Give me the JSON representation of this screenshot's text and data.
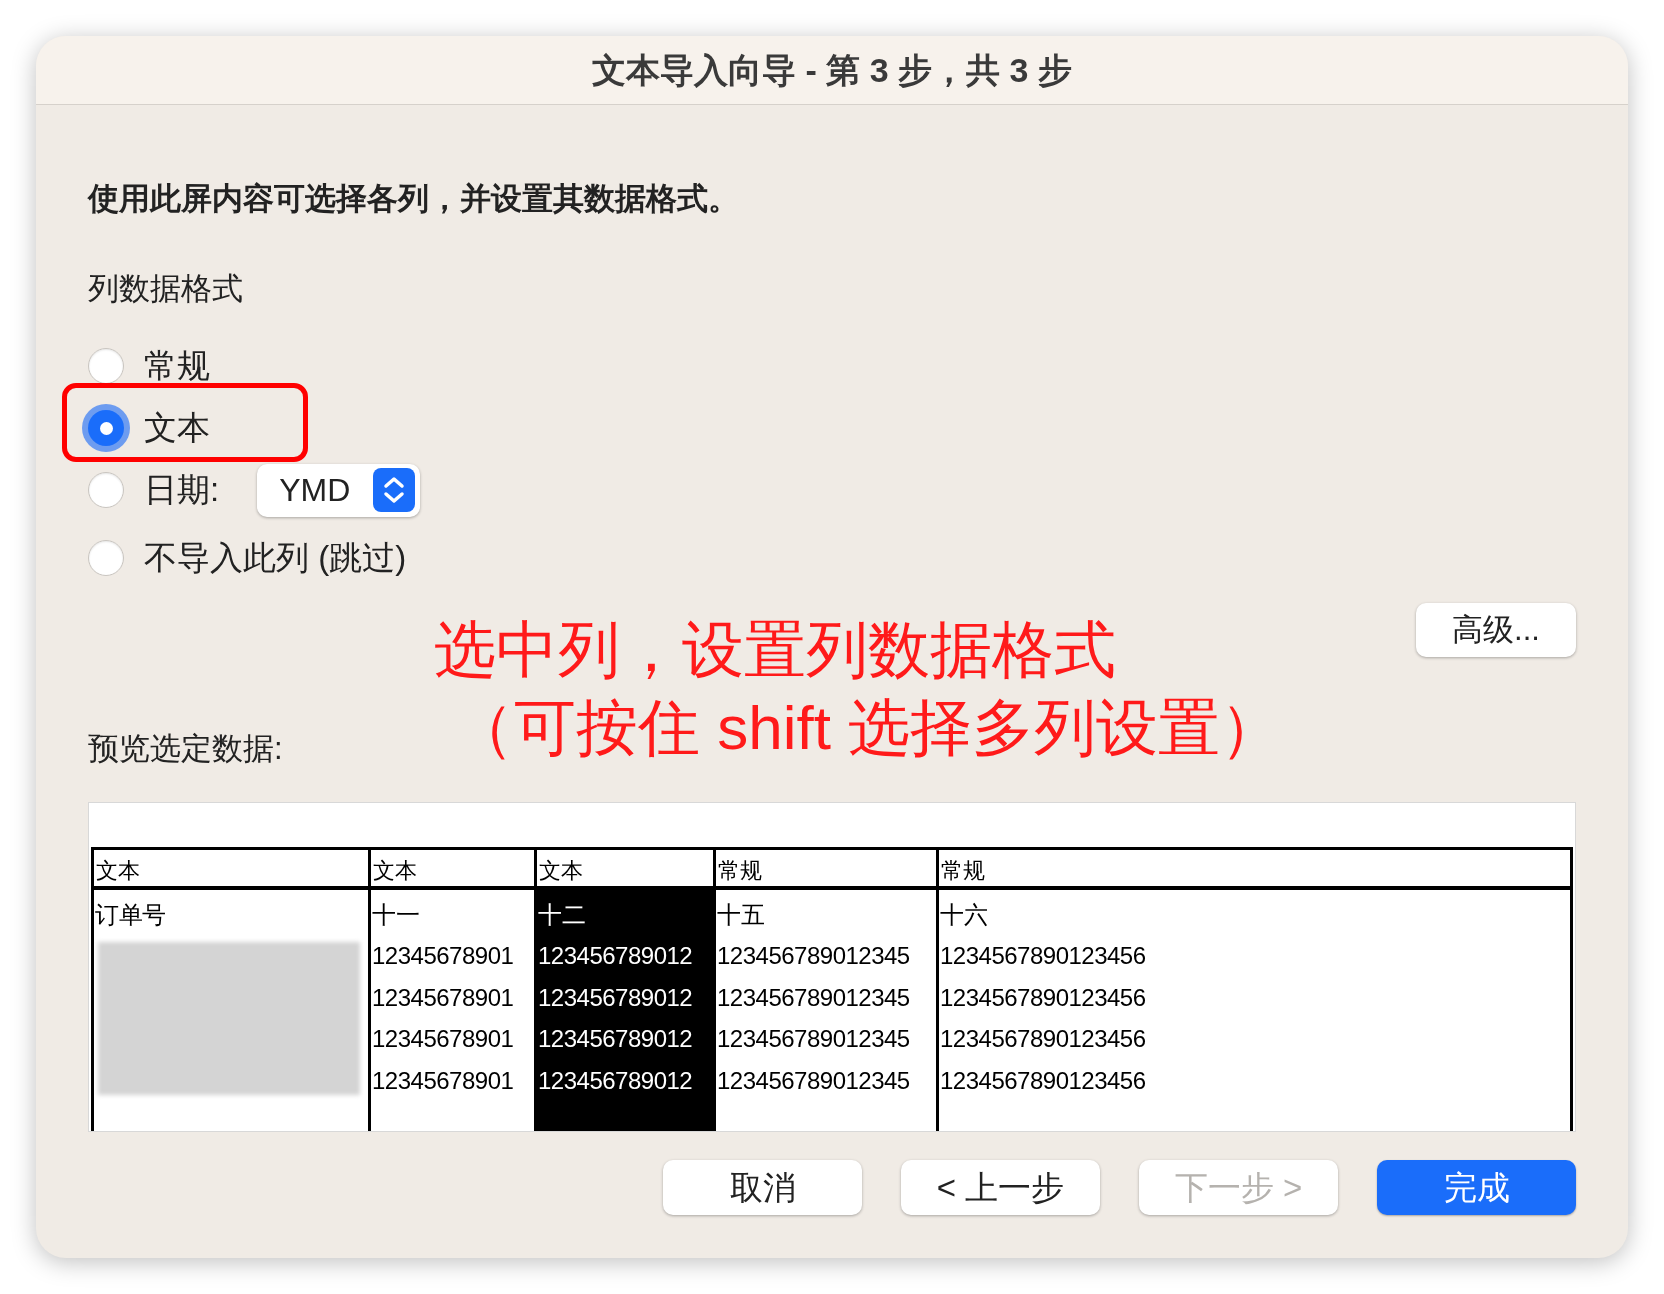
{
  "window": {
    "title": "文本导入向导 - 第 3 步，共 3 步"
  },
  "instruction": "使用此屏内容可选择各列，并设置其数据格式。",
  "format_label": "列数据格式",
  "formats": [
    {
      "label": "常规",
      "selected": false
    },
    {
      "label": "文本",
      "selected": true
    },
    {
      "label": "日期:",
      "selected": false,
      "select": "YMD"
    },
    {
      "label": "不导入此列 (跳过)",
      "selected": false
    }
  ],
  "advanced_button": "高级...",
  "annotation": [
    "选中列，设置列数据格式",
    "（可按住 shift 选择多列设置）"
  ],
  "preview_label": "预览选定数据:",
  "preview_columns": [
    {
      "format": "文本",
      "selected": false,
      "blurred": true,
      "cells": [
        "订单号"
      ]
    },
    {
      "format": "文本",
      "selected": false,
      "blurred": false,
      "cells": [
        "十一",
        "12345678901",
        "12345678901",
        "12345678901",
        "12345678901"
      ]
    },
    {
      "format": "文本",
      "selected": true,
      "blurred": false,
      "cells": [
        "十二",
        "123456789012",
        "123456789012",
        "123456789012",
        "123456789012"
      ]
    },
    {
      "format": "常规",
      "selected": false,
      "blurred": false,
      "cells": [
        "十五",
        "123456789012345",
        "123456789012345",
        "123456789012345",
        "123456789012345"
      ]
    },
    {
      "format": "常规",
      "selected": false,
      "blurred": false,
      "cells": [
        "十六",
        "1234567890123456",
        "1234567890123456",
        "1234567890123456",
        "1234567890123456"
      ]
    }
  ],
  "buttons": [
    {
      "label": "取消",
      "kind": "normal",
      "disabled": false
    },
    {
      "label": "< 上一步",
      "kind": "normal",
      "disabled": false
    },
    {
      "label": "下一步 >",
      "kind": "normal",
      "disabled": true
    },
    {
      "label": "完成",
      "kind": "default",
      "disabled": false
    }
  ]
}
